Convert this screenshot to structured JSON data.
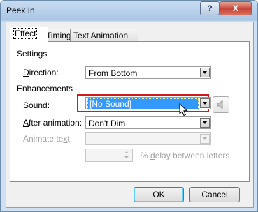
{
  "window": {
    "title": "Peek In"
  },
  "titlebar": {
    "help_label": "?",
    "close_label": "X"
  },
  "tabs": [
    {
      "label": "Effect",
      "active": true
    },
    {
      "label": "Timing",
      "active": false
    },
    {
      "label": "Text Animation",
      "active": false
    }
  ],
  "settings": {
    "heading": "Settings",
    "direction_label_u": "D",
    "direction_label_rest": "irection:",
    "direction_value": "From Bottom"
  },
  "enhancements": {
    "heading": "Enhancements",
    "sound_label_u": "S",
    "sound_label_rest": "ound:",
    "sound_value": "[No Sound]",
    "after_label_u": "A",
    "after_label_rest": "fter animation:",
    "after_value": "Don't Dim",
    "animate_text_label_pre": "Animate te",
    "animate_text_label_u": "x",
    "animate_text_label_post": "t:",
    "animate_text_value": "",
    "delay_value": "",
    "delay_label_pre": "% ",
    "delay_label_u": "d",
    "delay_label_post": "elay between letters"
  },
  "buttons": {
    "ok": "OK",
    "cancel": "Cancel"
  },
  "colors": {
    "highlight_border": "#d11a1a",
    "selection": "#3399ff"
  },
  "icons": {
    "speaker": "speaker-icon",
    "cursor": "mouse-pointer-icon"
  }
}
